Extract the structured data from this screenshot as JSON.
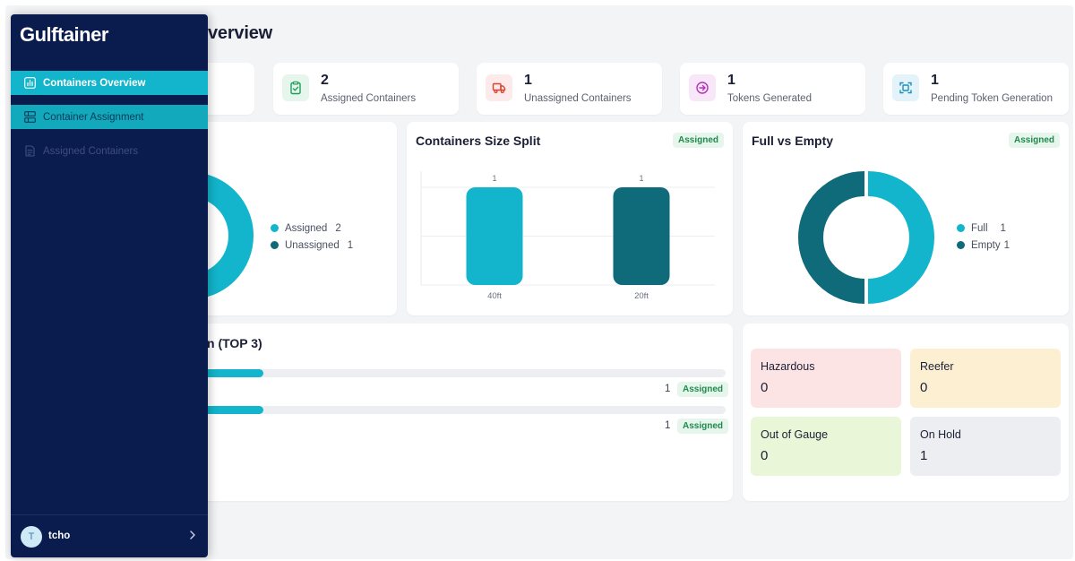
{
  "app": {
    "brand": "Gulftainer"
  },
  "page": {
    "title_visible": "verview"
  },
  "sidebar": {
    "items": [
      {
        "label": "Containers Overview",
        "icon": "bar-chart-icon",
        "state": "active"
      },
      {
        "label": "Container Assignment",
        "icon": "grid-icon",
        "state": "highlighted"
      },
      {
        "label": "Assigned Containers",
        "icon": "document-icon",
        "state": "disabled"
      }
    ],
    "user": {
      "initial": "T",
      "name": "tcho"
    }
  },
  "stats": [
    {
      "value": "2",
      "label": "Assigned Containers",
      "icon": "clipboard-check-icon",
      "color": "#1e9e5a",
      "bg": "#e6f6ec"
    },
    {
      "value": "1",
      "label": "Unassigned Containers",
      "icon": "truck-icon",
      "color": "#d9422f",
      "bg": "#fdeaea"
    },
    {
      "value": "1",
      "label": "Tokens Generated",
      "icon": "arrow-circle-icon",
      "color": "#b52fb8",
      "bg": "#f8e7f8"
    },
    {
      "value": "1",
      "label": "Pending Token Generation",
      "icon": "scan-icon",
      "color": "#1a8fb8",
      "bg": "#e4f3f9"
    }
  ],
  "assignment_donut": {
    "legend": [
      {
        "label": "Assigned",
        "value": "2",
        "color": "#12b5cb"
      },
      {
        "label": "Unassigned",
        "value": "1",
        "color": "#0f6a7a"
      }
    ]
  },
  "size_split": {
    "title": "Containers Size Split",
    "badge": "Assigned",
    "chart_data": {
      "type": "bar",
      "categories": [
        "40ft",
        "20ft"
      ],
      "values": [
        1,
        1
      ],
      "colors": [
        "#12b5cb",
        "#0f6a7a"
      ],
      "ylim": [
        0,
        1
      ],
      "grid": true
    }
  },
  "full_empty": {
    "title": "Full vs Empty",
    "badge": "Assigned",
    "legend": [
      {
        "label": "Full",
        "value": "1",
        "color": "#12b5cb"
      },
      {
        "label": "Empty",
        "value": "1",
        "color": "#0f6a7a"
      }
    ]
  },
  "top3": {
    "title_visible": "n (TOP 3)",
    "rows": [
      {
        "count": "1",
        "badge": "Assigned",
        "fraction": 0.17
      },
      {
        "count": "1",
        "badge": "Assigned",
        "fraction": 0.17
      }
    ]
  },
  "categories": [
    {
      "label": "Hazardous",
      "value": "0",
      "bg": "#fde4e4"
    },
    {
      "label": "Reefer",
      "value": "0",
      "bg": "#fdf0d2"
    },
    {
      "label": "Out of Gauge",
      "value": "0",
      "bg": "#eaf6d8"
    },
    {
      "label": "On Hold",
      "value": "1",
      "bg": "#eceef1"
    }
  ]
}
